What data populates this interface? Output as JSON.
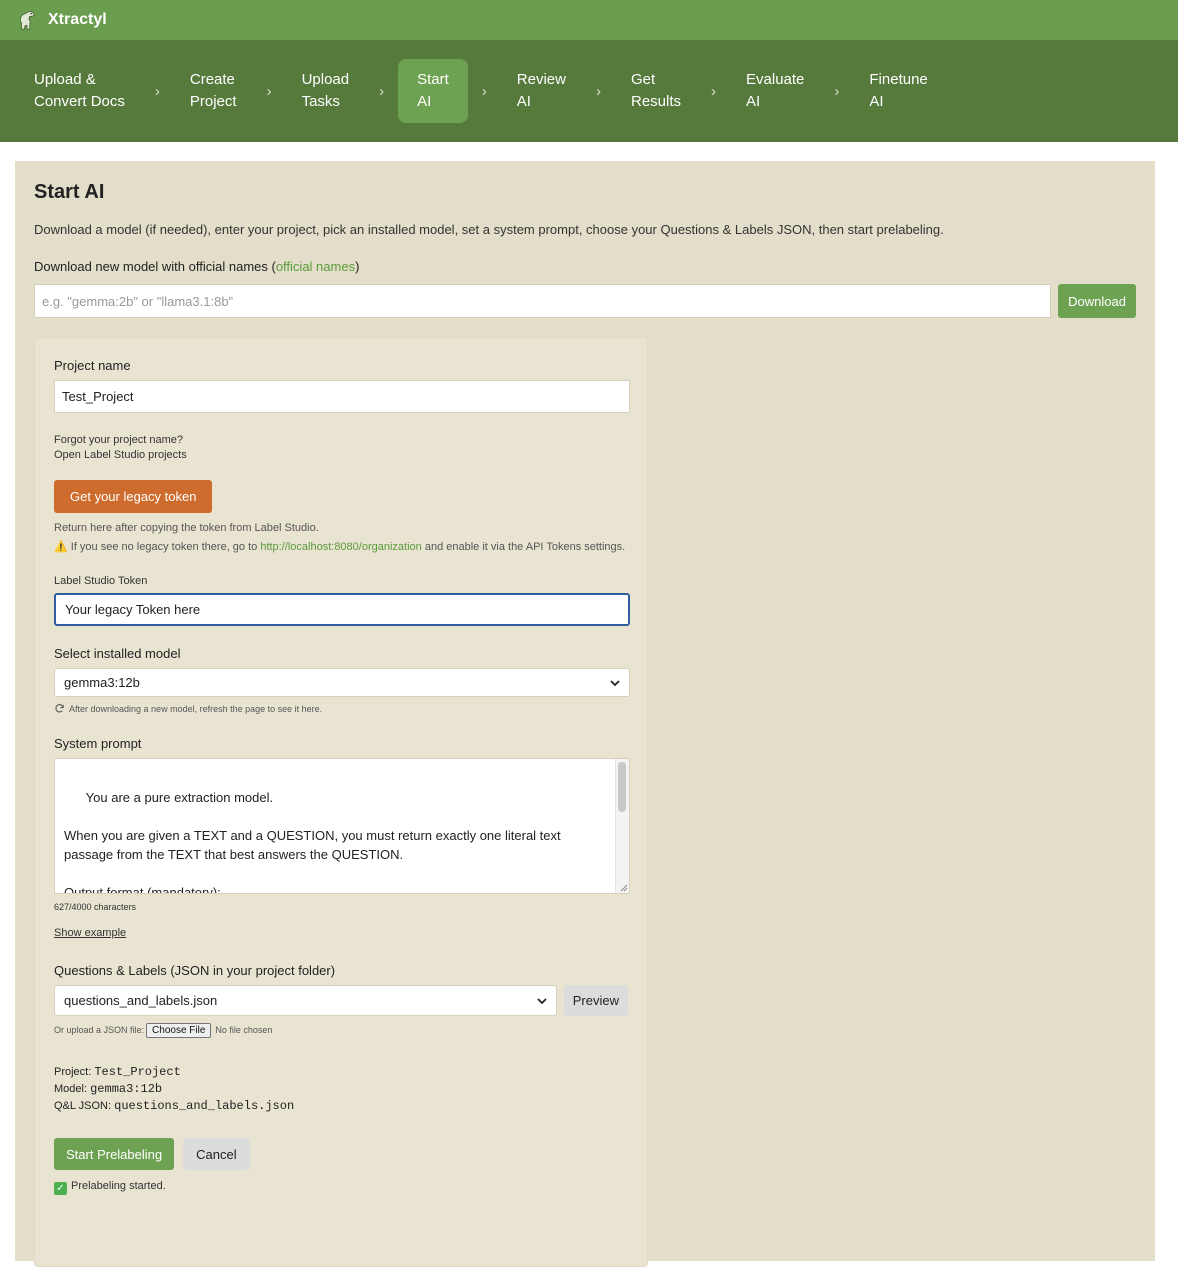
{
  "app": {
    "brand": "Xtractyl",
    "logo_icon": "dinosaur-logo-icon"
  },
  "steps": [
    {
      "l1": "Upload &",
      "l2": "Convert Docs"
    },
    {
      "l1": "Create",
      "l2": "Project"
    },
    {
      "l1": "Upload",
      "l2": "Tasks"
    },
    {
      "l1": "Start",
      "l2": "AI",
      "active": true
    },
    {
      "l1": "Review",
      "l2": "AI"
    },
    {
      "l1": "Get",
      "l2": "Results"
    },
    {
      "l1": "Evaluate",
      "l2": "AI"
    },
    {
      "l1": "Finetune",
      "l2": "AI"
    }
  ],
  "step_separator": "›",
  "page": {
    "title": "Start AI",
    "description": "Download a model (if needed), enter your project, pick an installed model, set a system prompt, choose your Questions & Labels JSON, then start prelabeling."
  },
  "download": {
    "label_prefix": "Download new model with official names (",
    "label_link": "official names",
    "label_suffix": ")",
    "placeholder": "e.g. \"gemma:2b\" or \"llama3.1:8b\"",
    "button": "Download"
  },
  "project": {
    "label": "Project name",
    "value": "Test_Project",
    "forgot": "Forgot your project name?",
    "open_link": "Open Label Studio projects"
  },
  "token": {
    "button": "Get your legacy token",
    "return_note": "Return here after copying the token from Label Studio.",
    "warn_prefix": " If you see no legacy token there, go to ",
    "warn_link": "http://localhost:8080/organization",
    "warn_suffix": " and enable it via the API Tokens settings.",
    "field_label": "Label Studio Token",
    "field_value": "Your legacy Token here"
  },
  "model": {
    "label": "Select installed model",
    "selected": "gemma3:12b",
    "refresh_note": "After downloading a new model, refresh the page to see it here."
  },
  "prompt": {
    "label": "System prompt",
    "text": "You are a pure extraction model.\n\nWhen you are given a TEXT and a QUESTION, you must return exactly one literal text\npassage from the TEXT that best answers the QUESTION.\n\nOutput format (mandatory):\n- Return EXACTLY ONE matching passage, with no introduction, no explanations, no",
    "count": "627/4000 characters",
    "show_example": "Show example"
  },
  "ql": {
    "label": "Questions & Labels (JSON in your project folder)",
    "selected": "questions_and_labels.json",
    "preview_button": "Preview",
    "upload_label": "Or upload a JSON file:",
    "choose_button": "Choose File",
    "no_file": "No file chosen"
  },
  "summary": {
    "project_label": "Project:",
    "project_value": "Test_Project",
    "model_label": "Model:",
    "model_value": "gemma3:12b",
    "ql_label": "Q&L JSON:",
    "ql_value": "questions_and_labels.json"
  },
  "actions": {
    "start": "Start Prelabeling",
    "cancel": "Cancel",
    "status": "Prelabeling started."
  },
  "colors": {
    "topbar": "#6b9d4f",
    "stepnav": "#567a3c",
    "panel": "#e3dec9",
    "accent_green": "#6ea253",
    "accent_orange": "#cd6c2c",
    "link_green": "#5a9a3a"
  }
}
